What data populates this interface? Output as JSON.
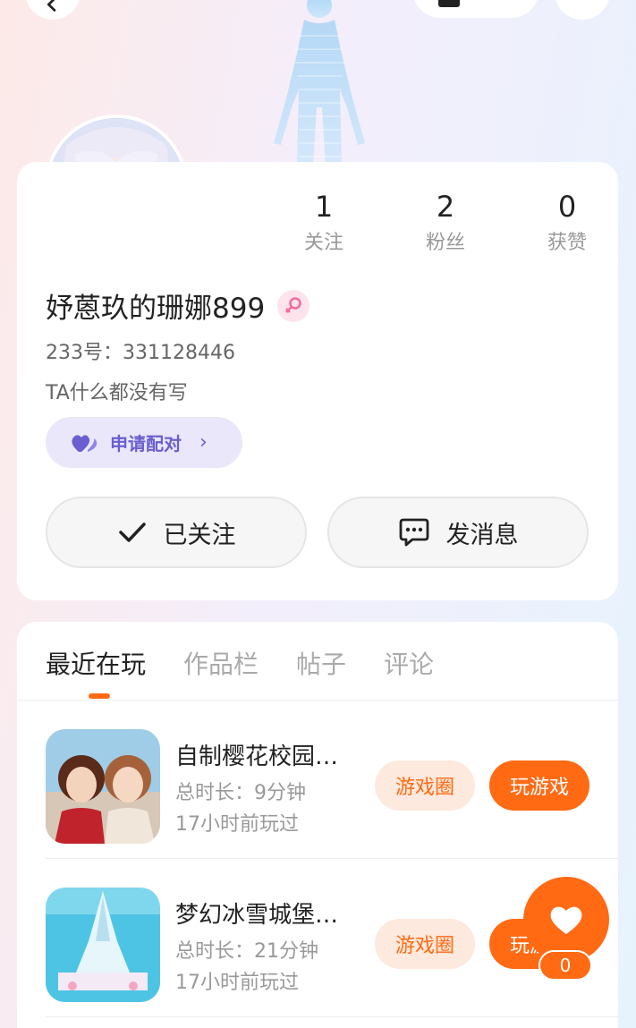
{
  "header": {
    "back_icon": "chevron-left-icon",
    "share_icon": "square-icon",
    "more_icon": "more-icon"
  },
  "profile": {
    "stats": [
      {
        "num": "1",
        "label": "关注"
      },
      {
        "num": "2",
        "label": "粉丝"
      },
      {
        "num": "0",
        "label": "获赞"
      }
    ],
    "name": "妤蒽玖的珊娜899",
    "gender_icon": "female-icon",
    "uid": "233号：331128446",
    "bio": "TA什么都没有写",
    "pair_label": "申请配对",
    "follow_label": "已关注",
    "message_label": "发消息"
  },
  "tabs": [
    {
      "label": "最近在玩",
      "active": true
    },
    {
      "label": "作品栏",
      "active": false
    },
    {
      "label": "帖子",
      "active": false
    },
    {
      "label": "评论",
      "active": false
    }
  ],
  "games": [
    {
      "title": "自制樱花校园…",
      "duration": "总时长：9分钟",
      "last_played": "17小时前玩过",
      "circle_label": "游戏圈",
      "play_label": "玩游戏"
    },
    {
      "title": "梦幻冰雪城堡…",
      "duration": "总时长：21分钟",
      "last_played": "17小时前玩过",
      "circle_label": "游戏圈",
      "play_label": "玩游戏"
    }
  ],
  "like": {
    "count": "0"
  },
  "colors": {
    "accent": "#ff6a13",
    "pair": "#6a5ed0"
  }
}
